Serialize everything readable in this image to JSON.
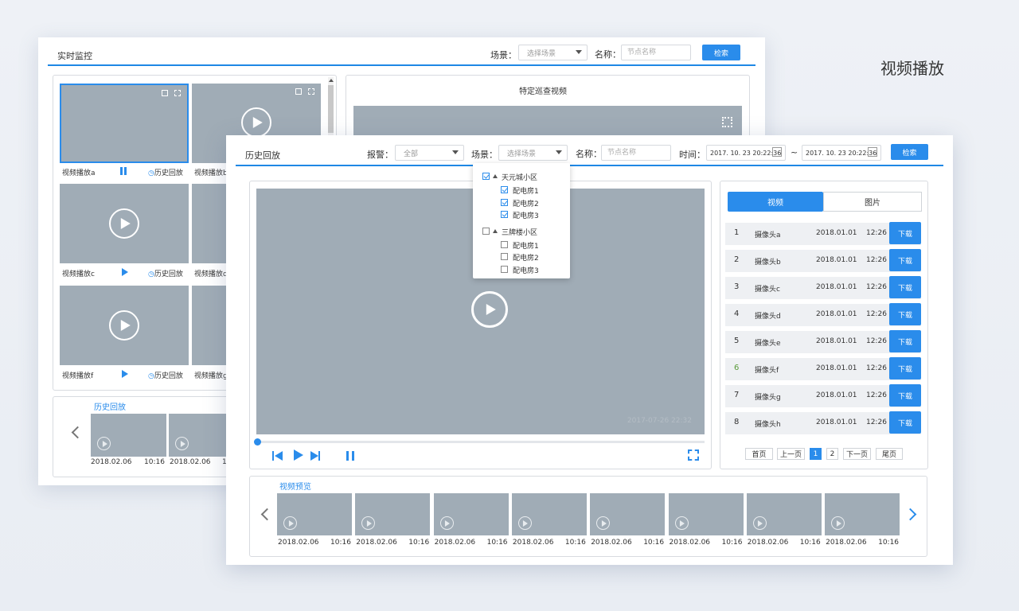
{
  "page_title": "视频播放",
  "back": {
    "title": "实时监控",
    "scene_label": "场景：",
    "scene_placeholder": "选择场景",
    "name_label": "名称：",
    "name_placeholder": "节点名称",
    "search_label": "检索",
    "patrol_title": "特定巡查视频",
    "history_label": "历史回放",
    "cells": [
      {
        "name": "视频播放a",
        "action": "历史回放"
      },
      {
        "name": "视频播放b"
      },
      {
        "name": "视频播放c",
        "action": "历史回放"
      },
      {
        "name": "视频播放d"
      },
      {
        "name": "视频播放f",
        "action": "历史回放"
      },
      {
        "name": "视频播放g"
      }
    ],
    "strip_title": "历史回放",
    "strip_items": [
      {
        "date": "2018.02.06",
        "time": "10:16"
      },
      {
        "date": "2018.02.06",
        "time": "1"
      }
    ]
  },
  "front": {
    "title": "历史回放",
    "alarm_label": "报警：",
    "alarm_value": "全部",
    "scene_label": "场景：",
    "scene_placeholder": "选择场景",
    "name_label": "名称：",
    "name_placeholder": "节点名称",
    "time_label": "时间：",
    "time_start": "2017. 10. 23    20:22:36",
    "time_sep": "~",
    "time_end": "2017. 10. 23    20:22:36",
    "search_label": "检索",
    "video_timestamp": "2017-07-26 22:32",
    "progress": 0.0,
    "tabs": [
      "视频",
      "图片"
    ],
    "list": [
      {
        "idx": "1",
        "name": "摄像头a",
        "date": "2018.01.01",
        "time": "12:26",
        "action": "下载"
      },
      {
        "idx": "2",
        "name": "摄像头b",
        "date": "2018.01.01",
        "time": "12:26",
        "action": "下载"
      },
      {
        "idx": "3",
        "name": "摄像头c",
        "date": "2018.01.01",
        "time": "12:26",
        "action": "下载"
      },
      {
        "idx": "4",
        "name": "摄像头d",
        "date": "2018.01.01",
        "time": "12:26",
        "action": "下载"
      },
      {
        "idx": "5",
        "name": "摄像头e",
        "date": "2018.01.01",
        "time": "12:26",
        "action": "下载"
      },
      {
        "idx": "6",
        "name": "摄像头f",
        "date": "2018.01.01",
        "time": "12:26",
        "action": "下载"
      },
      {
        "idx": "7",
        "name": "摄像头g",
        "date": "2018.01.01",
        "time": "12:26",
        "action": "下载"
      },
      {
        "idx": "8",
        "name": "摄像头h",
        "date": "2018.01.01",
        "time": "12:26",
        "action": "下载"
      }
    ],
    "pagination": {
      "first": "首页",
      "prev": "上一页",
      "pages": [
        "1",
        "2"
      ],
      "next": "下一页",
      "last": "尾页",
      "current": "1"
    },
    "preview_title": "视频预览",
    "preview_items": [
      {
        "date": "2018.02.06",
        "time": "10:16"
      },
      {
        "date": "2018.02.06",
        "time": "10:16"
      },
      {
        "date": "2018.02.06",
        "time": "10:16"
      },
      {
        "date": "2018.02.06",
        "time": "10:16"
      },
      {
        "date": "2018.02.06",
        "time": "10:16"
      },
      {
        "date": "2018.02.06",
        "time": "10:16"
      },
      {
        "date": "2018.02.06",
        "time": "10:16"
      },
      {
        "date": "2018.02.06",
        "time": "10:16"
      }
    ],
    "dropdown": {
      "groups": [
        {
          "name": "天元城小区",
          "checked": true,
          "items": [
            {
              "name": "配电房1",
              "checked": true
            },
            {
              "name": "配电房2",
              "checked": true
            },
            {
              "name": "配电房3",
              "checked": true
            }
          ]
        },
        {
          "name": "三牌楼小区",
          "checked": false,
          "items": [
            {
              "name": "配电房1",
              "checked": false
            },
            {
              "name": "配电房2",
              "checked": false
            },
            {
              "name": "配电房3",
              "checked": false
            }
          ]
        }
      ]
    }
  },
  "colors": {
    "accent": "#2a8ceb",
    "thumb": "#a0acb6",
    "row_bg": "#eef0f3"
  }
}
